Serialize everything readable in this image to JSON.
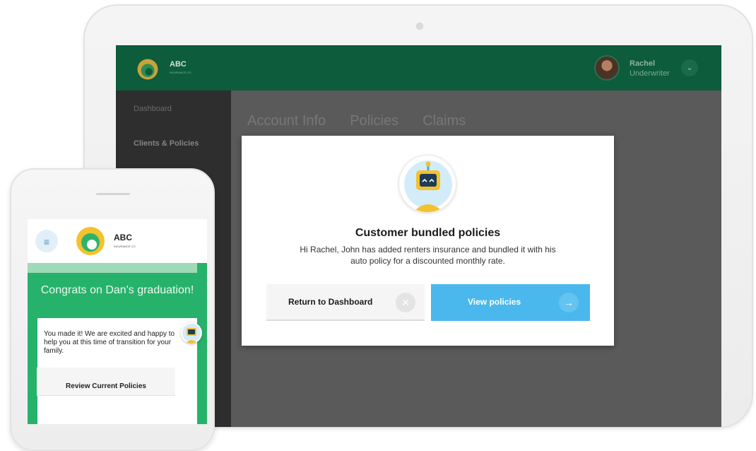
{
  "tablet": {
    "header": {
      "brand": "ABC",
      "brand_sub": "INSURANCE CO",
      "user_name": "Rachel",
      "user_role": "Underwriter",
      "chevron_icon": "chevron-down-icon"
    },
    "nav": {
      "items": [
        {
          "label": "Dashboard"
        },
        {
          "label": "Clients & Policies"
        }
      ]
    },
    "tabs": [
      {
        "label": "Account Info"
      },
      {
        "label": "Policies"
      },
      {
        "label": "Claims"
      }
    ]
  },
  "modal": {
    "icon": "robot-icon",
    "title": "Customer bundled policies",
    "message_line1": "Hi Rachel, John has added renters insurance and bundled it with his",
    "message_line2": "auto policy for a discounted monthly rate.",
    "return_button": {
      "label": "Return to Dashboard",
      "icon": "close-icon"
    },
    "view_button": {
      "label": "View policies",
      "icon": "arrow-right-icon"
    }
  },
  "phone": {
    "menu_icon": "hamburger-icon",
    "brand": "ABC",
    "brand_sub": "INSURANCE CO",
    "congrats": "Congrats on Dan's graduation!",
    "card_text": "You made it! We are excited and happy to help you at this time of transition for your family.",
    "review_button": "Review Current Policies"
  },
  "colors": {
    "header_green": "#0d5c3b",
    "phone_green": "#27b26b",
    "accent_blue": "#4ab8ec",
    "logo_yellow": "#f2c230",
    "logo_green": "#2fb36a"
  }
}
